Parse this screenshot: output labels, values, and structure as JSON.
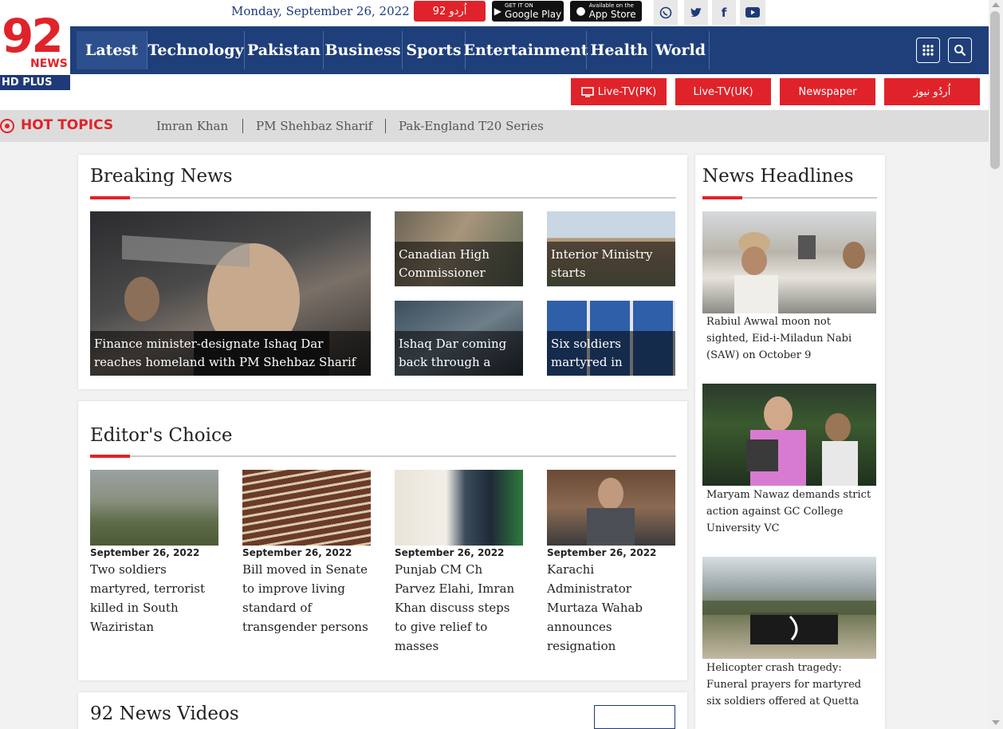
{
  "header": {
    "date": "Monday, September 26, 2022",
    "urdu_badge": "اُردو 92",
    "google_play": {
      "small": "GET IT ON",
      "label": "Google Play"
    },
    "app_store": {
      "small": "Available on the",
      "label": "App Store"
    },
    "logo": {
      "number": "92",
      "word": "NEWS",
      "sub": "HD PLUS"
    },
    "social_icons": [
      "whatsapp-icon",
      "twitter-icon",
      "facebook-icon",
      "youtube-icon"
    ]
  },
  "nav": {
    "items": [
      "Latest",
      "Technology",
      "Pakistan",
      "Business",
      "Sports",
      "Entertainment",
      "Health",
      "World"
    ],
    "icons": [
      "apps-grid-icon",
      "search-icon"
    ]
  },
  "live_buttons": [
    "Live-TV(PK)",
    "Live-TV(UK)",
    "Newspaper",
    "اُردُو نیوز"
  ],
  "hot_topics": {
    "title": "HOT TOPICS",
    "links": [
      "Imran Khan",
      "PM Shehbaz Sharif",
      "Pak-England T20 Series"
    ]
  },
  "breaking": {
    "title": "Breaking News",
    "main": "Finance minister-designate Ishaq Dar reaches homeland with PM Shehbaz Sharif",
    "tiles": [
      "Canadian High Commissioner",
      "Interior Ministry starts",
      "Ishaq Dar coming back through a",
      "Six soldiers martyred in"
    ]
  },
  "editors": {
    "title": "Editor's Choice",
    "items": [
      {
        "date": "September 26, 2022",
        "title": "Two soldiers martyred, terrorist killed in South Waziristan"
      },
      {
        "date": "September 26, 2022",
        "title": "Bill moved in Senate to improve living standard of transgender persons"
      },
      {
        "date": "September 26, 2022",
        "title": "Punjab CM Ch Parvez Elahi, Imran Khan discuss steps to give relief to masses"
      },
      {
        "date": "September 26, 2022",
        "title": "Karachi Administrator Murtaza Wahab announces resignation"
      }
    ]
  },
  "headlines": {
    "title": "News Headlines",
    "items": [
      "Rabiul Awwal moon not sighted, Eid-i-Miladun Nabi (SAW) on October 9",
      "Maryam Nawaz demands strict action against GC College University VC",
      "Helicopter crash tragedy: Funeral prayers for martyred six soldiers offered at Quetta"
    ]
  },
  "videos": {
    "title": "92 News Videos"
  },
  "colors": {
    "brand_blue": "#1f3f7a",
    "brand_red": "#e0232a"
  }
}
